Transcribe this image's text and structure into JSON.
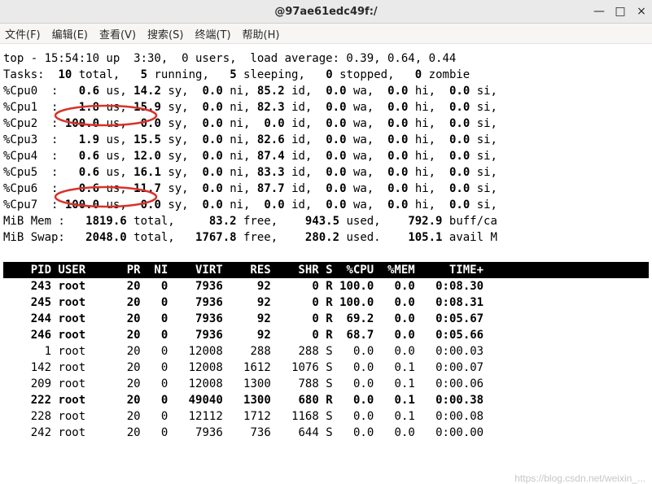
{
  "window": {
    "title": "@97ae61edc49f:/"
  },
  "menu": {
    "file": "文件(F)",
    "edit": "编辑(E)",
    "view": "查看(V)",
    "search": "搜索(S)",
    "term": "终端(T)",
    "help": "帮助(H)"
  },
  "top": {
    "summary_line": "top - 15:54:10 up  3:30,  0 users,  load average: 0.39, 0.64, 0.44",
    "tasks": {
      "prefix": "Tasks:  ",
      "total": "10",
      "running": "5",
      "sleeping": "5",
      "stopped": "0",
      "zombie": "0"
    },
    "cpus": [
      {
        "name": "%Cpu0  :",
        "us": "0.6",
        "sy": "14.2",
        "ni": "0.0",
        "id": "85.2",
        "wa": "0.0",
        "hi": "0.0",
        "si": "0.0"
      },
      {
        "name": "%Cpu1  :",
        "us": "1.8",
        "sy": "15.9",
        "ni": "0.0",
        "id": "82.3",
        "wa": "0.0",
        "hi": "0.0",
        "si": "0.0"
      },
      {
        "name": "%Cpu2  :",
        "us": "100.0",
        "sy": "0.0",
        "ni": "0.0",
        "id": "0.0",
        "wa": "0.0",
        "hi": "0.0",
        "si": "0.0"
      },
      {
        "name": "%Cpu3  :",
        "us": "1.9",
        "sy": "15.5",
        "ni": "0.0",
        "id": "82.6",
        "wa": "0.0",
        "hi": "0.0",
        "si": "0.0"
      },
      {
        "name": "%Cpu4  :",
        "us": "0.6",
        "sy": "12.0",
        "ni": "0.0",
        "id": "87.4",
        "wa": "0.0",
        "hi": "0.0",
        "si": "0.0"
      },
      {
        "name": "%Cpu5  :",
        "us": "0.6",
        "sy": "16.1",
        "ni": "0.0",
        "id": "83.3",
        "wa": "0.0",
        "hi": "0.0",
        "si": "0.0"
      },
      {
        "name": "%Cpu6  :",
        "us": "0.6",
        "sy": "11.7",
        "ni": "0.0",
        "id": "87.7",
        "wa": "0.0",
        "hi": "0.0",
        "si": "0.0"
      },
      {
        "name": "%Cpu7  :",
        "us": "100.0",
        "sy": "0.0",
        "ni": "0.0",
        "id": "0.0",
        "wa": "0.0",
        "hi": "0.0",
        "si": "0.0"
      }
    ],
    "mem": {
      "label": "MiB Mem :",
      "total": "1819.6",
      "free": "83.2",
      "used": "943.5",
      "buff": "792.9",
      "buff_label": "buff/ca"
    },
    "swap": {
      "label": "MiB Swap:",
      "total": "2048.0",
      "free": "1767.8",
      "used": "280.2",
      "avail": "105.1",
      "avail_label": "avail M"
    }
  },
  "table": {
    "header": {
      "pid": "PID",
      "user": "USER",
      "pr": "PR",
      "ni": "NI",
      "virt": "VIRT",
      "res": "RES",
      "shr": "SHR",
      "s": "S",
      "cpu": "%CPU",
      "mem": "%MEM",
      "time": "TIME+"
    },
    "rows": [
      {
        "pid": "243",
        "user": "root",
        "pr": "20",
        "ni": "0",
        "virt": "7936",
        "res": "92",
        "shr": "0",
        "s": "R",
        "cpu": "100.0",
        "mem": "0.0",
        "time": "0:08.30",
        "bold": true
      },
      {
        "pid": "245",
        "user": "root",
        "pr": "20",
        "ni": "0",
        "virt": "7936",
        "res": "92",
        "shr": "0",
        "s": "R",
        "cpu": "100.0",
        "mem": "0.0",
        "time": "0:08.31",
        "bold": true
      },
      {
        "pid": "244",
        "user": "root",
        "pr": "20",
        "ni": "0",
        "virt": "7936",
        "res": "92",
        "shr": "0",
        "s": "R",
        "cpu": "69.2",
        "mem": "0.0",
        "time": "0:05.67",
        "bold": true
      },
      {
        "pid": "246",
        "user": "root",
        "pr": "20",
        "ni": "0",
        "virt": "7936",
        "res": "92",
        "shr": "0",
        "s": "R",
        "cpu": "68.7",
        "mem": "0.0",
        "time": "0:05.66",
        "bold": true
      },
      {
        "pid": "1",
        "user": "root",
        "pr": "20",
        "ni": "0",
        "virt": "12008",
        "res": "288",
        "shr": "288",
        "s": "S",
        "cpu": "0.0",
        "mem": "0.0",
        "time": "0:00.03",
        "bold": false
      },
      {
        "pid": "142",
        "user": "root",
        "pr": "20",
        "ni": "0",
        "virt": "12008",
        "res": "1612",
        "shr": "1076",
        "s": "S",
        "cpu": "0.0",
        "mem": "0.1",
        "time": "0:00.07",
        "bold": false
      },
      {
        "pid": "209",
        "user": "root",
        "pr": "20",
        "ni": "0",
        "virt": "12008",
        "res": "1300",
        "shr": "788",
        "s": "S",
        "cpu": "0.0",
        "mem": "0.1",
        "time": "0:00.06",
        "bold": false
      },
      {
        "pid": "222",
        "user": "root",
        "pr": "20",
        "ni": "0",
        "virt": "49040",
        "res": "1300",
        "shr": "680",
        "s": "R",
        "cpu": "0.0",
        "mem": "0.1",
        "time": "0:00.38",
        "bold": true
      },
      {
        "pid": "228",
        "user": "root",
        "pr": "20",
        "ni": "0",
        "virt": "12112",
        "res": "1712",
        "shr": "1168",
        "s": "S",
        "cpu": "0.0",
        "mem": "0.1",
        "time": "0:00.08",
        "bold": false
      },
      {
        "pid": "242",
        "user": "root",
        "pr": "20",
        "ni": "0",
        "virt": "7936",
        "res": "736",
        "shr": "644",
        "s": "S",
        "cpu": "0.0",
        "mem": "0.0",
        "time": "0:00.00",
        "bold": false
      }
    ]
  },
  "watermark": "https://blog.csdn.net/weixin_..."
}
